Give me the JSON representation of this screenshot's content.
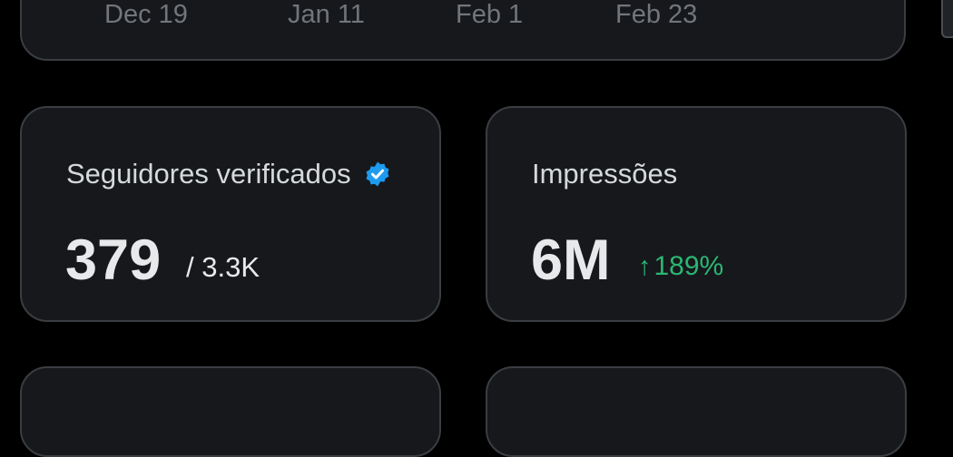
{
  "chart": {
    "x_tick_labels": [
      "Dec 19",
      "Jan 11",
      "Feb 1",
      "Feb 23"
    ]
  },
  "stats": {
    "verified_followers": {
      "title": "Seguidores verificados",
      "value": "379",
      "total": "/ 3.3K",
      "badge_icon": "verified-badge-icon",
      "badge_color": "#1d9bf0"
    },
    "impressions": {
      "title": "Impressões",
      "value": "6M",
      "delta_arrow": "↑",
      "delta": "189%",
      "delta_color": "#2bb673"
    }
  },
  "colors": {
    "background": "#000000",
    "card": "#16181c",
    "card_border": "#3a3d42"
  }
}
